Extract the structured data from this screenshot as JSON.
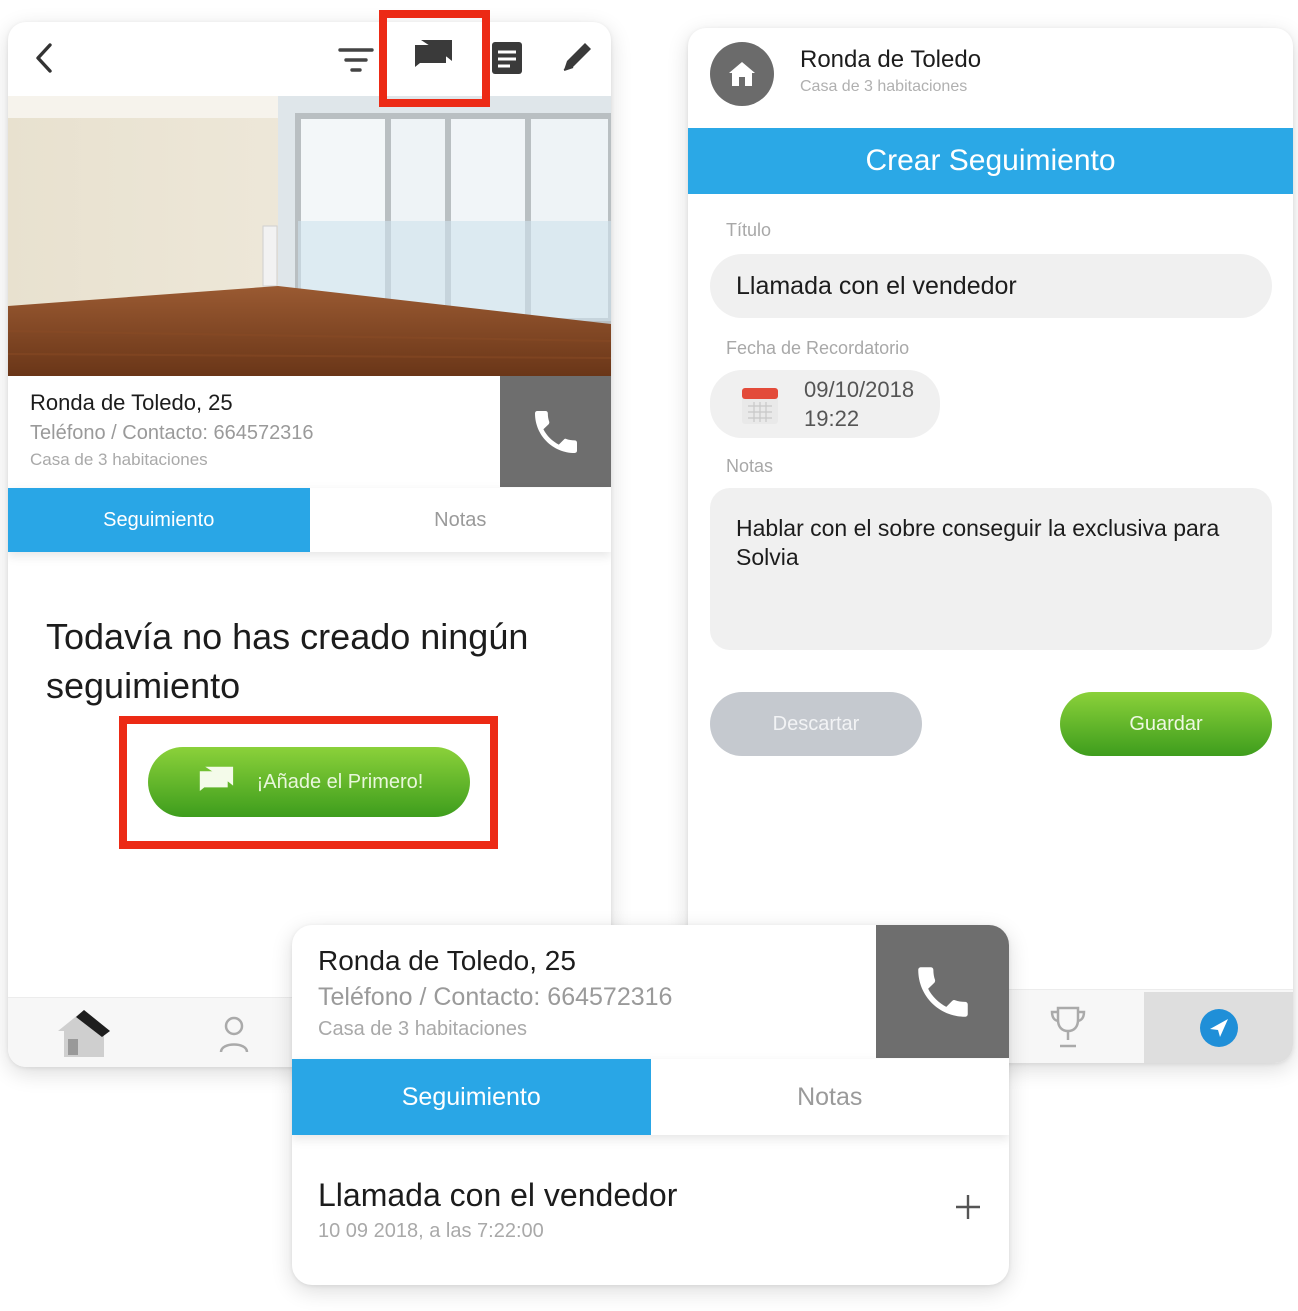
{
  "left_screen": {
    "top_icons": [
      "chevron-left-icon",
      "filter-icon",
      "chat-bubbles-icon",
      "list-icon",
      "pencil-icon"
    ],
    "property": {
      "title": "Ronda de Toledo, 25",
      "contact": "Teléfono / Contacto: 664572316",
      "subtitle": "Casa de 3 habitaciones"
    },
    "tabs": [
      "Seguimiento",
      "Notas"
    ],
    "empty_message": "Todavía no has creado ningún seguimiento",
    "add_button_label": "¡Añade el Primero!",
    "nav_icons": [
      "house-icon",
      "user-icon"
    ]
  },
  "right_screen": {
    "header": {
      "title": "Ronda de Toledo",
      "subtitle": "Casa de 3 habitaciones"
    },
    "banner": "Crear Seguimiento",
    "titulo_label": "Título",
    "titulo_value": "Llamada con el vendedor",
    "fecha_label": "Fecha de Recordatorio",
    "fecha_date": "09/10/2018",
    "fecha_time": "19:22",
    "notas_label": "Notas",
    "notas_value": "Hablar con el sobre conseguir la exclusiva para Solvia",
    "discard_label": "Descartar",
    "save_label": "Guardar",
    "nav_icons": [
      "trophy-icon",
      "compass-icon"
    ]
  },
  "bottom_card": {
    "property": {
      "title": "Ronda de Toledo, 25",
      "contact": "Teléfono / Contacto: 664572316",
      "subtitle": "Casa de 3 habitaciones"
    },
    "tabs": [
      "Seguimiento",
      "Notas"
    ],
    "item": {
      "title": "Llamada con el vendedor",
      "date": "10 09 2018, a las 7:22:00"
    }
  },
  "colors": {
    "accent_blue": "#29a6e6",
    "green": "#5ab42a",
    "highlight_red": "#ec2a15",
    "call_gray": "#6e6e6e"
  }
}
